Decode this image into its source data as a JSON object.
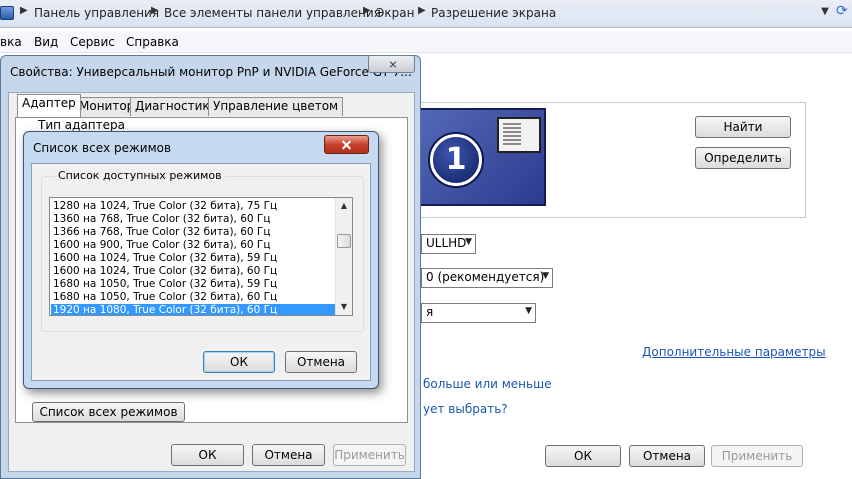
{
  "addressbar": {
    "breadcrumbs": [
      "Панель управления",
      "Все элементы панели управления",
      "Экран",
      "Разрешение экрана"
    ],
    "separator": "▶",
    "dropdown": "▼",
    "refresh": "⟳"
  },
  "menubar": {
    "items": [
      "вка",
      "Вид",
      "Сервис",
      "Справка"
    ]
  },
  "screen_settings": {
    "identify_label": "Найти",
    "detect_label": "Определить",
    "monitor_number": "1",
    "display_combo": "ULLHD",
    "resolution_combo": "0 (рекомендуется)",
    "orientation_combo": "я",
    "advanced_link": "Дополнительные параметры",
    "link_size": "больше или меньше",
    "link_choose": "ует выбрать?",
    "ok_label": "ОК",
    "cancel_label": "Отмена",
    "apply_label": "Применить"
  },
  "properties_dialog": {
    "title": "Свойства: Универсальный монитор PnP и NVIDIA GeForce GT 7...",
    "tabs": [
      "Адаптер",
      "Монитор",
      "Диагностика",
      "Управление цветом"
    ],
    "adapter_type_label": "Тип адаптера",
    "list_all_modes_button": "Список всех режимов",
    "ok_label": "ОК",
    "cancel_label": "Отмена",
    "apply_label": "Применить"
  },
  "modes_dialog": {
    "title": "Список всех режимов",
    "group_label": "Список доступных режимов",
    "modes": [
      "1280 на 1024, True Color (32 бита), 75 Гц",
      "1360 на 768, True Color (32 бита), 60 Гц",
      "1366 на 768, True Color (32 бита), 60 Гц",
      "1600 на 900, True Color (32 бита), 60 Гц",
      "1600 на 1024, True Color (32 бита), 59 Гц",
      "1600 на 1024, True Color (32 бита), 60 Гц",
      "1680 на 1050, True Color (32 бита), 59 Гц",
      "1680 на 1050, True Color (32 бита), 60 Гц",
      "1920 на 1080, True Color (32 бита), 60 Гц"
    ],
    "selected_index": 8,
    "ok_label": "ОК",
    "cancel_label": "Отмена"
  },
  "colors": {
    "selection": "#3399ff",
    "link": "#1a57b0",
    "close_red": "#c7402a"
  }
}
